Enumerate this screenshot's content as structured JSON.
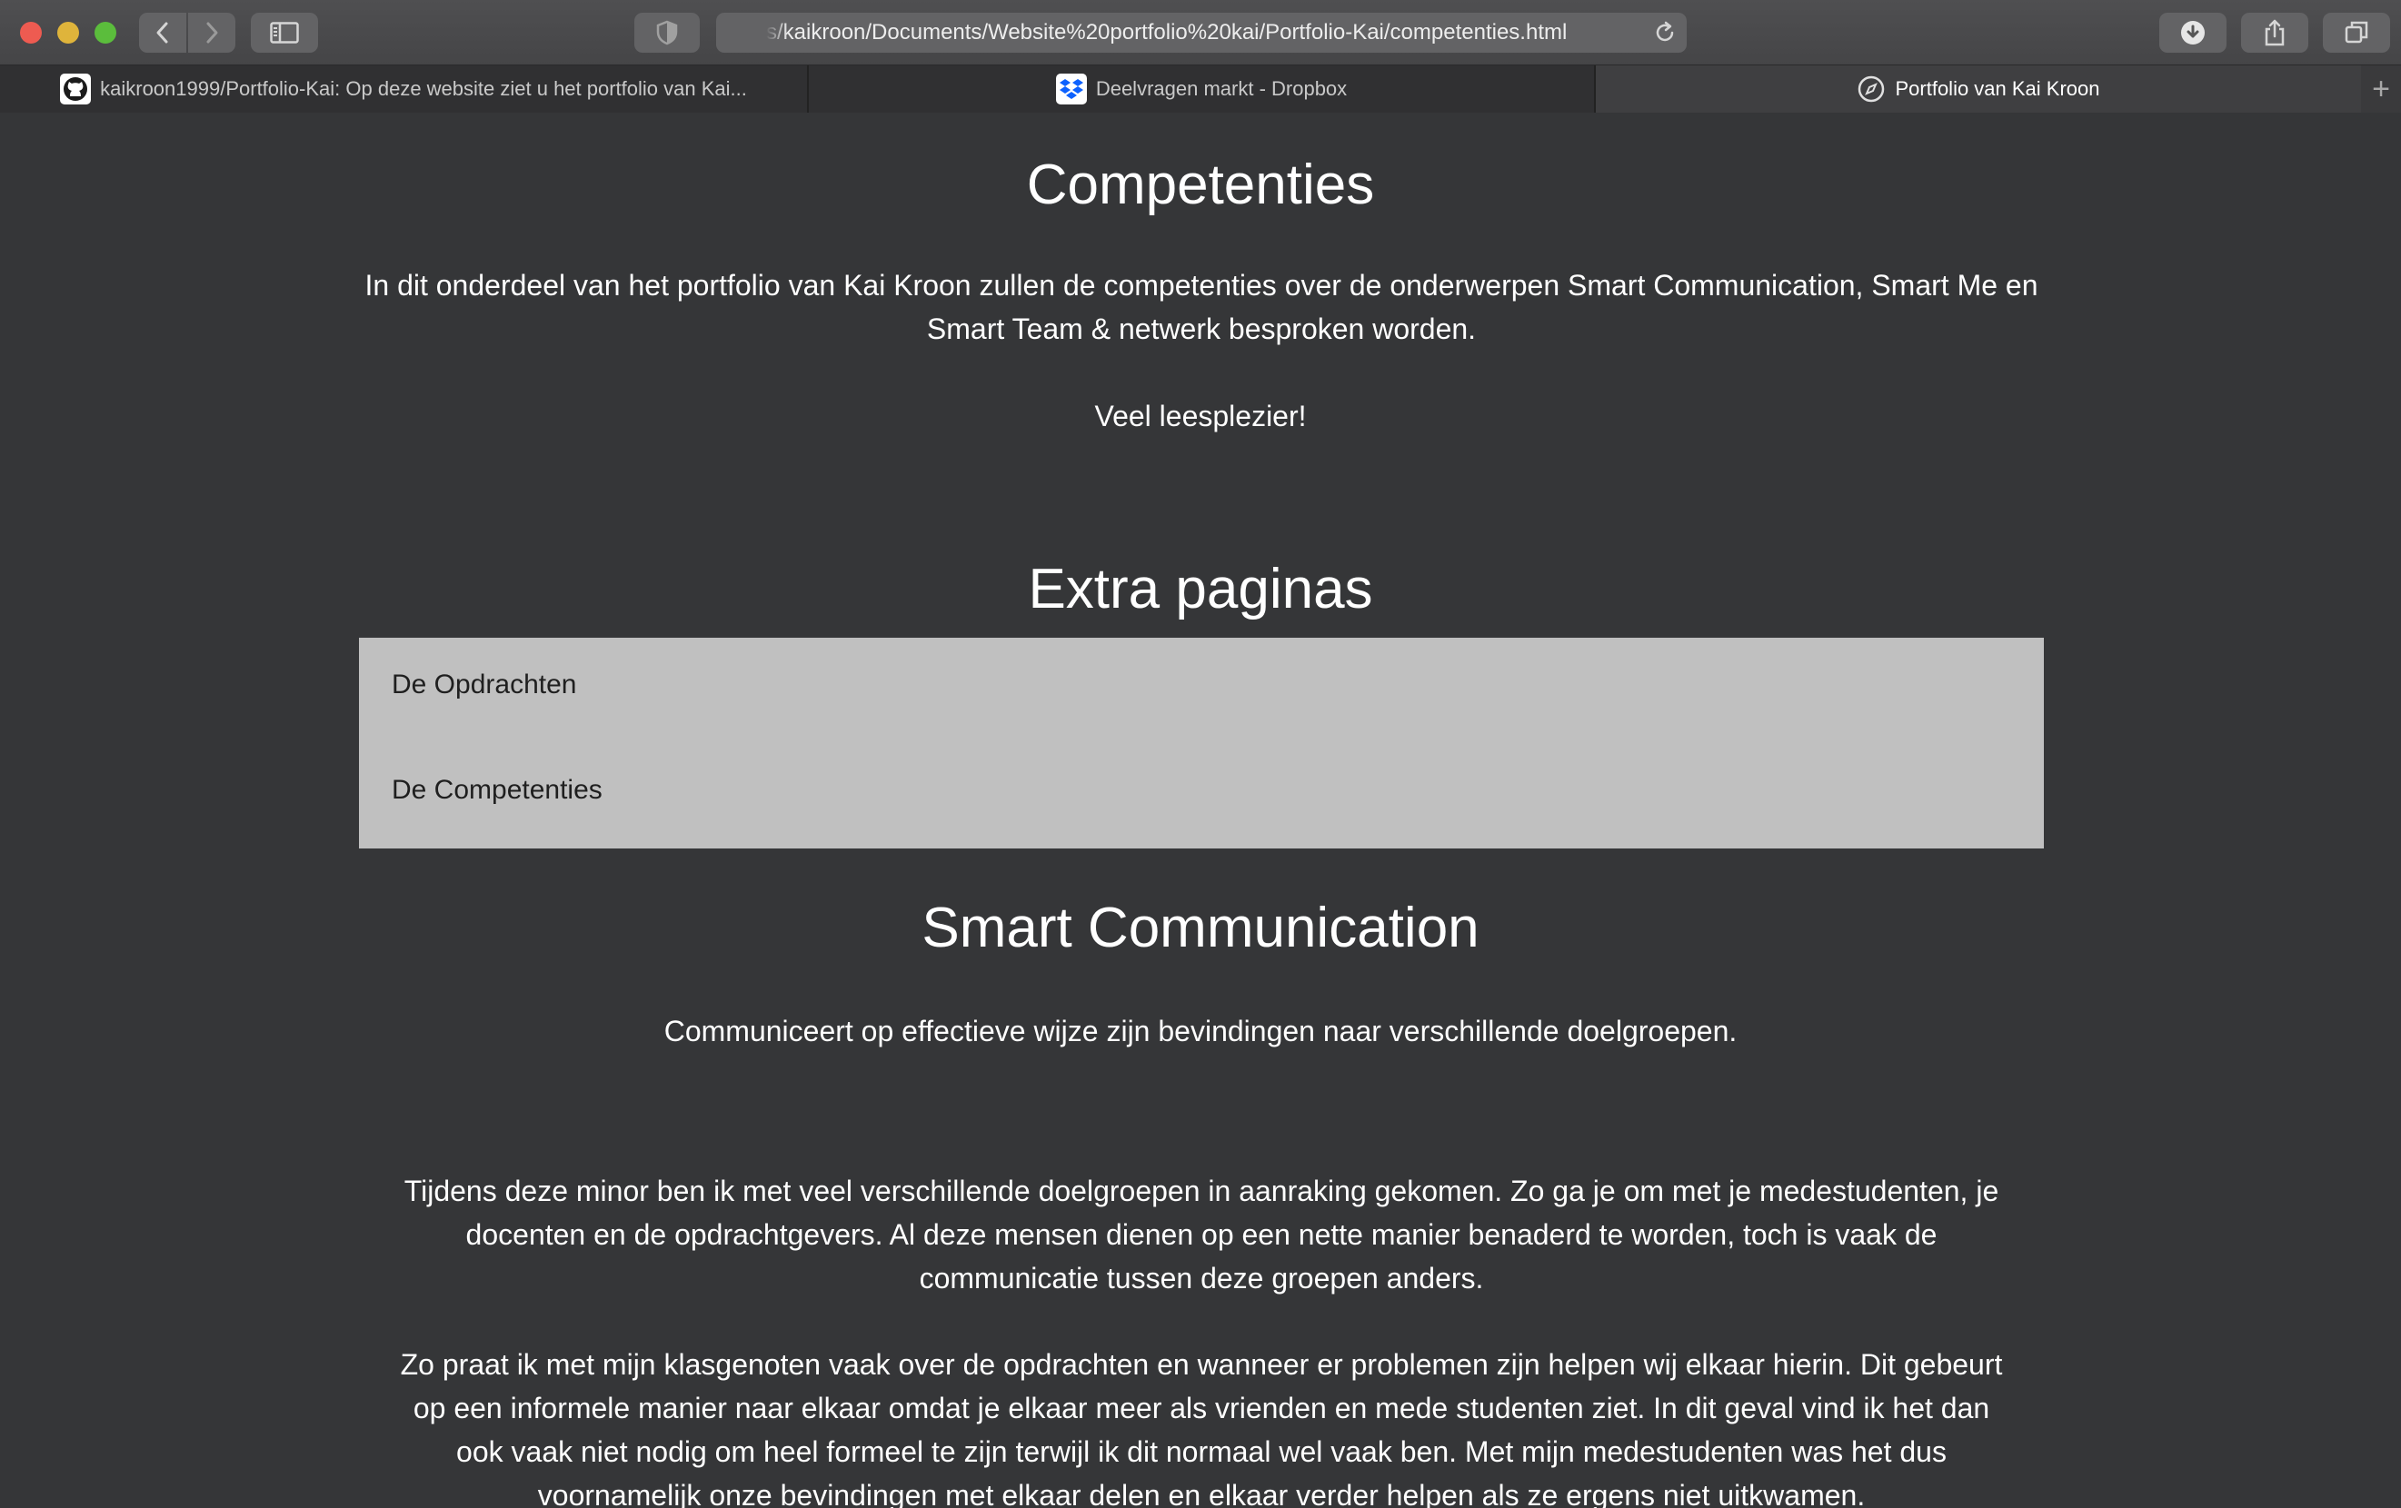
{
  "browser": {
    "url": "s/kaikroon/Documents/Website%20portfolio%20kai/Portfolio-Kai/competenties.html",
    "tabs": [
      {
        "label": "kaikroon1999/Portfolio-Kai: Op deze website ziet u het portfolio van Kai...",
        "favicon": "github-icon"
      },
      {
        "label": "Deelvragen markt - Dropbox",
        "favicon": "dropbox-icon"
      },
      {
        "label": "Portfolio van Kai Kroon",
        "favicon": "compass-icon"
      }
    ],
    "new_tab_label": "+"
  },
  "page": {
    "title": "Competenties",
    "intro": "In dit onderdeel van het portfolio van Kai Kroon zullen de competenties over de onderwerpen Smart Communication, Smart Me en Smart Team & netwerk besproken worden.",
    "greeting": "Veel leesplezier!",
    "extra_heading": "Extra paginas",
    "nav_links": [
      "De Opdrachten",
      "De Competenties"
    ],
    "section_title": "Smart Communication",
    "section_subtitle": "Communiceert op effectieve wijze zijn bevindingen naar verschillende doelgroepen.",
    "paragraph1": "Tijdens deze minor ben ik met veel verschillende doelgroepen in aanraking gekomen. Zo ga je om met je medestudenten, je docenten en de opdrachtgevers. Al deze mensen dienen op een nette manier benaderd te worden, toch is vaak de communicatie tussen deze groepen anders.",
    "paragraph2": "Zo praat ik met mijn klasgenoten vaak over de opdrachten en wanneer er problemen zijn helpen wij elkaar hierin. Dit gebeurt op een informele manier naar elkaar omdat je elkaar meer als vrienden en mede studenten ziet. In dit geval vind ik het dan ook vaak niet nodig om heel formeel te zijn terwijl ik dit normaal wel vaak ben. Met mijn medestudenten was het dus voornamelijk onze bevindingen met elkaar delen en elkaar verder helpen als ze ergens niet uitkwamen."
  },
  "colors": {
    "page_bg": "#353638",
    "nav_box_bg": "#c0c0c0",
    "text": "#ffffff"
  }
}
